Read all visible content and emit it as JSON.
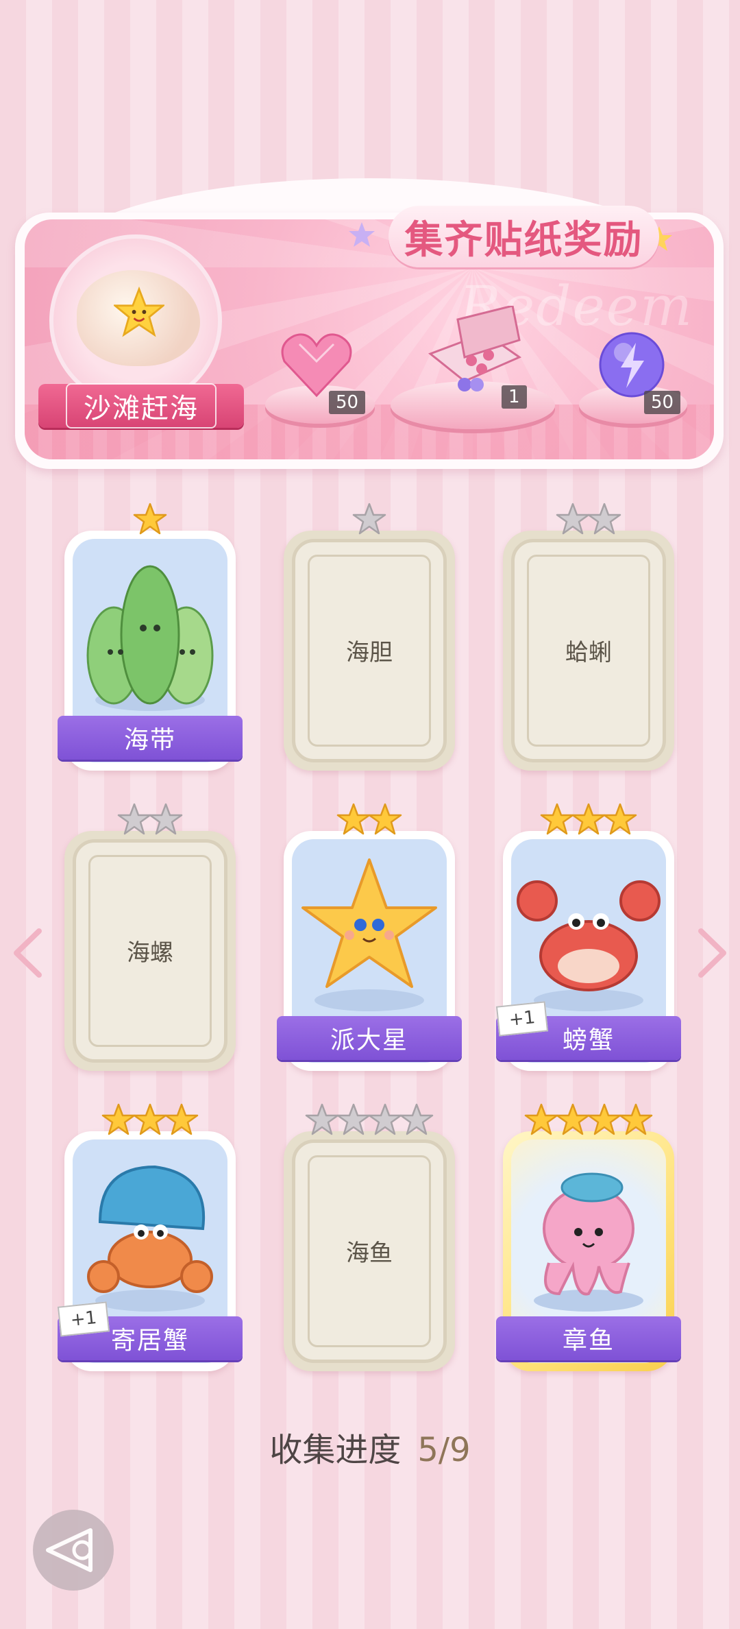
{
  "banner": {
    "title": "集齐贴纸奖励",
    "watermark": "Redeem",
    "theme_label": "沙滩赶海",
    "rewards": [
      {
        "icon": "pink-heart-gem-icon",
        "count": "50"
      },
      {
        "icon": "gift-box-icon",
        "count": "1"
      },
      {
        "icon": "lightning-orb-icon",
        "count": "50"
      }
    ]
  },
  "cards": [
    {
      "name": "海带",
      "stars": 1,
      "stars_color": "gold",
      "collected": true,
      "icon": "seaweed-icon"
    },
    {
      "name": "海胆",
      "stars": 1,
      "stars_color": "gray",
      "collected": false
    },
    {
      "name": "蛤蜊",
      "stars": 2,
      "stars_color": "gray",
      "collected": false
    },
    {
      "name": "海螺",
      "stars": 2,
      "stars_color": "gray",
      "collected": false
    },
    {
      "name": "派大星",
      "stars": 2,
      "stars_color": "gold",
      "collected": true,
      "icon": "starfish-icon"
    },
    {
      "name": "螃蟹",
      "stars": 3,
      "stars_color": "gold",
      "collected": true,
      "icon": "crab-icon",
      "badge": "+1"
    },
    {
      "name": "寄居蟹",
      "stars": 3,
      "stars_color": "gold",
      "collected": true,
      "icon": "hermit-crab-icon",
      "badge": "+1"
    },
    {
      "name": "海鱼",
      "stars": 4,
      "stars_color": "gray",
      "collected": false
    },
    {
      "name": "章鱼",
      "stars": 4,
      "stars_color": "gold",
      "collected": true,
      "icon": "octopus-icon",
      "golden": true
    }
  ],
  "progress": {
    "label": "收集进度",
    "value": "5/9"
  },
  "colors": {
    "accent_purple": "#8a5cdc",
    "accent_pink": "#e4587f",
    "bg_pink": "#f6d7e0"
  }
}
